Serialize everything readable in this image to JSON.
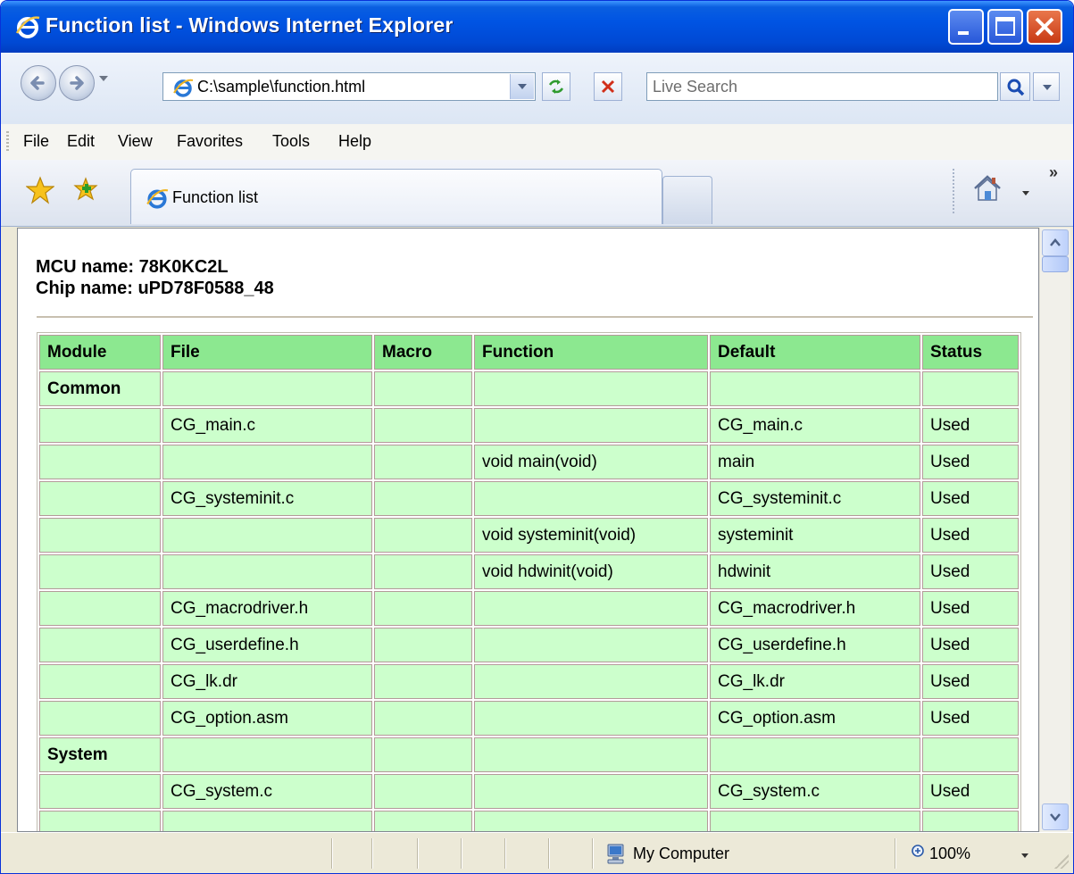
{
  "window": {
    "title": "Function list - Windows Internet Explorer"
  },
  "navigation": {
    "address": "C:\\sample\\function.html",
    "search_placeholder": "Live Search"
  },
  "menu": [
    "File",
    "Edit",
    "View",
    "Favorites",
    "Tools",
    "Help"
  ],
  "tab": {
    "label": "Function list"
  },
  "page": {
    "mcu_name": "MCU name: 78K0KC2L",
    "chip_name": "Chip name: uPD78F0588_48"
  },
  "table": {
    "headers": [
      "Module",
      "File",
      "Macro",
      "Function",
      "Default",
      "Status"
    ],
    "rows": [
      [
        "Common",
        "",
        "",
        "",
        "",
        ""
      ],
      [
        "",
        "CG_main.c",
        "",
        "",
        "CG_main.c",
        "Used"
      ],
      [
        "",
        "",
        "",
        "void main(void)",
        "main",
        "Used"
      ],
      [
        "",
        "CG_systeminit.c",
        "",
        "",
        "CG_systeminit.c",
        "Used"
      ],
      [
        "",
        "",
        "",
        "void systeminit(void)",
        "systeminit",
        "Used"
      ],
      [
        "",
        "",
        "",
        "void hdwinit(void)",
        "hdwinit",
        "Used"
      ],
      [
        "",
        "CG_macrodriver.h",
        "",
        "",
        "CG_macrodriver.h",
        "Used"
      ],
      [
        "",
        "CG_userdefine.h",
        "",
        "",
        "CG_userdefine.h",
        "Used"
      ],
      [
        "",
        "CG_lk.dr",
        "",
        "",
        "CG_lk.dr",
        "Used"
      ],
      [
        "",
        "CG_option.asm",
        "",
        "",
        "CG_option.asm",
        "Used"
      ],
      [
        "System",
        "",
        "",
        "",
        "",
        ""
      ],
      [
        "",
        "CG_system.c",
        "",
        "",
        "CG_system.c",
        "Used"
      ],
      [
        "",
        "",
        "",
        "",
        "",
        ""
      ]
    ]
  },
  "status": {
    "zone": "My Computer",
    "zoom": "100%"
  },
  "colors": {
    "header_bg": "#8ce890",
    "cell_bg": "#ccffcc",
    "titlebar": "#0054e3"
  }
}
